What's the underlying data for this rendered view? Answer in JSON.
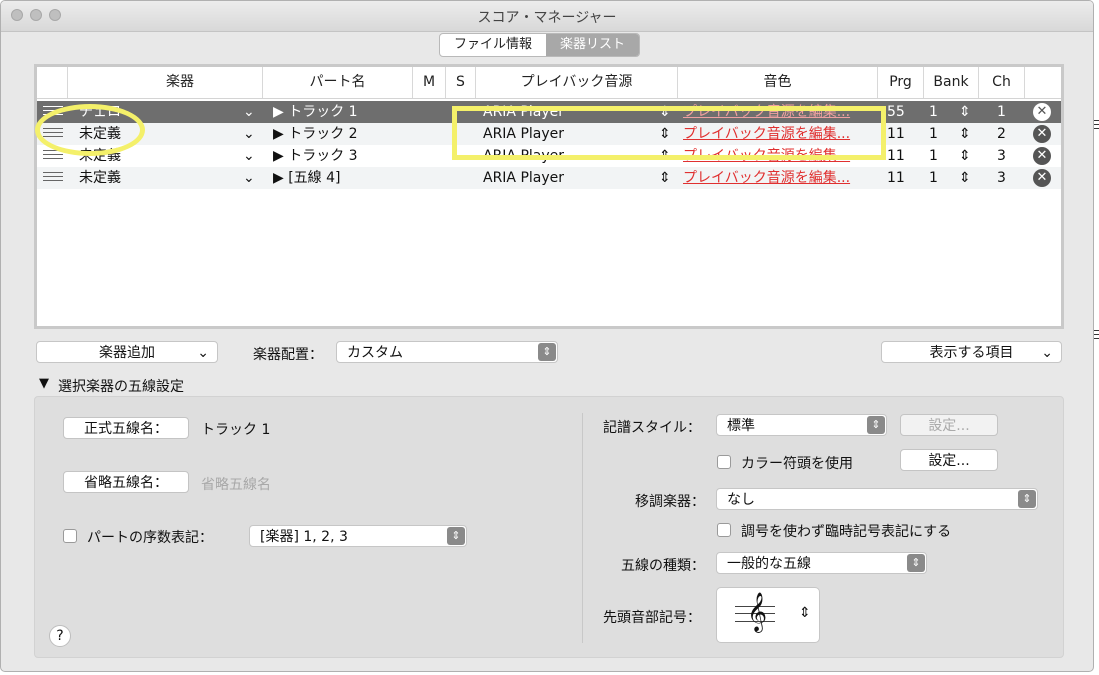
{
  "window": {
    "title": "スコア・マネージャー"
  },
  "tabs": [
    {
      "label": "ファイル情報",
      "active": false
    },
    {
      "label": "楽器リスト",
      "active": true
    }
  ],
  "table": {
    "headers": {
      "instrument": "楽器",
      "part": "パート名",
      "m": "M",
      "s": "S",
      "playback": "プレイバック音源",
      "sound": "音色",
      "prg": "Prg",
      "bank": "Bank",
      "ch": "Ch"
    },
    "rows": [
      {
        "instrument": "チェロ",
        "part": "▶ トラック 1",
        "playback": "ARIA Player",
        "sound": "プレイバック音源を編集...",
        "prg": "55",
        "bank": "1",
        "ch": "1",
        "selected": true
      },
      {
        "instrument": "未定義",
        "part": "▶ トラック 2",
        "playback": "ARIA Player",
        "sound": "プレイバック音源を編集...",
        "prg": "11",
        "bank": "1",
        "ch": "2",
        "selected": false
      },
      {
        "instrument": "未定義",
        "part": "▶ トラック 3",
        "playback": "ARIA Player",
        "sound": "プレイバック音源を編集...",
        "prg": "11",
        "bank": "1",
        "ch": "3",
        "selected": false
      },
      {
        "instrument": "未定義",
        "part": "▶ [五線 4]",
        "playback": "ARIA Player",
        "sound": "プレイバック音源を編集...",
        "prg": "11",
        "bank": "1",
        "ch": "3",
        "selected": false
      }
    ]
  },
  "toolbar": {
    "add_instrument": "楽器追加",
    "arrangement_label": "楽器配置：",
    "arrangement_value": "カスタム",
    "display_items": "表示する項目"
  },
  "staff_settings": {
    "section_title": "選択楽器の五線設定",
    "full_name_button": "正式五線名：",
    "full_name_value": "トラック 1",
    "abbr_name_button": "省略五線名：",
    "abbr_name_placeholder": "省略五線名",
    "part_ordinal_label": "パートの序数表記：",
    "part_ordinal_value": "[楽器] 1, 2, 3",
    "notation_style_label": "記譜スタイル：",
    "notation_style_value": "標準",
    "settings_disabled": "設定...",
    "color_noteheads_label": "カラー符頭を使用",
    "settings_button": "設定...",
    "transposing_label": "移調楽器：",
    "transposing_value": "なし",
    "accidentals_label": "調号を使わず臨時記号表記にする",
    "staff_type_label": "五線の種類：",
    "staff_type_value": "一般的な五線",
    "clef_label": "先頭音部記号：",
    "clef_symbol": "𝄞",
    "help": "?"
  }
}
